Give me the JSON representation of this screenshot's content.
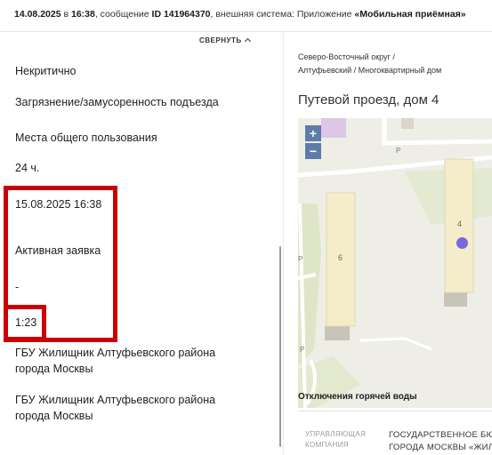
{
  "header": {
    "date": "14.08.2025",
    "in_word": "в",
    "time": "16:38",
    "message_prefix": ", сообщение",
    "message_id": "ID 141964370",
    "system_prefix": ", внешняя система: Приложение",
    "system_name": "«Мобильная приёмная»"
  },
  "left_panel": {
    "collapse_label": "СВЕРНУТЬ",
    "priority": "Некритично",
    "category": "Загрязнение/замусоренность подъезда",
    "location_type": "Места общего пользования",
    "deadline": "24 ч.",
    "created": "15.08.2025 16:38",
    "status": "Активная заявка",
    "dash": "-",
    "duration": "1:23",
    "executor_1": "ГБУ Жилищник Алтуфьевского района города Москвы",
    "executor_2": "ГБУ Жилищник Алтуфьевского района города Москвы",
    "highlight_color": "#cc0000"
  },
  "right_panel": {
    "breadcrumb_line1": "Северо-Восточный округ /",
    "breadcrumb_line2": "Алтуфьевский / Многоквартирный дом",
    "address": "Путевой проезд, дом 4",
    "map": {
      "zoom_in": "+",
      "zoom_out": "−",
      "building_6": "6",
      "building_4": "4",
      "parking_1": "P",
      "parking_2": "P",
      "parking_3": "P",
      "marker_color": "#7b68d8"
    },
    "hot_water_title": "Отключения горячей воды",
    "management_label_line1": "УПРАВЛЯЮЩАЯ",
    "management_label_line2": "КОМПАНИЯ",
    "management_value_line1": "ГОСУДАРСТВЕННОЕ БЮД",
    "management_value_line2": "ГОРОДА МОСКВЫ «ЖИЛ"
  }
}
